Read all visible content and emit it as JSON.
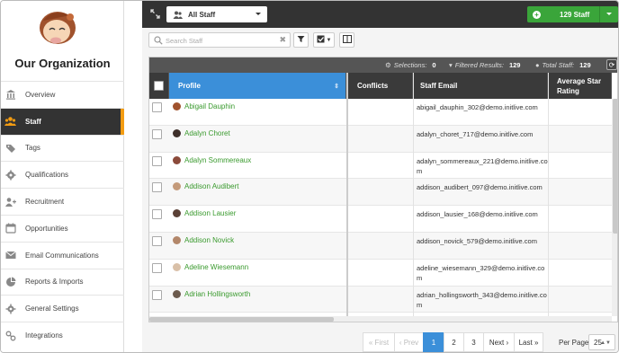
{
  "org": {
    "title": "Our Organization"
  },
  "sidebar": {
    "items": [
      {
        "label": "Overview",
        "icon": "bank-icon",
        "active": false
      },
      {
        "label": "Staff",
        "icon": "users-icon",
        "active": true
      },
      {
        "label": "Tags",
        "icon": "tags-icon",
        "active": false
      },
      {
        "label": "Qualifications",
        "icon": "gear-icon",
        "active": false
      },
      {
        "label": "Recruitment",
        "icon": "user-plus-icon",
        "active": false
      },
      {
        "label": "Opportunities",
        "icon": "calendar-icon",
        "active": false
      },
      {
        "label": "Email Communications",
        "icon": "envelope-icon",
        "active": false
      },
      {
        "label": "Reports & Imports",
        "icon": "pie-chart-icon",
        "active": false
      },
      {
        "label": "General Settings",
        "icon": "cog-icon",
        "active": false
      },
      {
        "label": "Integrations",
        "icon": "link-icon",
        "active": false
      }
    ]
  },
  "topbar": {
    "filter_select": "All Staff",
    "add_button": "129 Staff"
  },
  "search": {
    "placeholder": "Search Staff",
    "value": ""
  },
  "stats": {
    "selections_label": "Selections:",
    "selections": "0",
    "filtered_label": "Filtered Results:",
    "filtered": "129",
    "total_label": "Total Staff:",
    "total": "129"
  },
  "table": {
    "headers": {
      "profile": "Profile",
      "conflicts": "Conflicts",
      "email": "Staff Email",
      "rating": "Average Star Rating"
    },
    "rows": [
      {
        "name": "Abigail Dauphin",
        "email": "abigail_dauphin_302@demo.initlive.com",
        "avatar": "#a0522d"
      },
      {
        "name": "Adalyn Choret",
        "email": "adalyn_choret_717@demo.initlive.com",
        "avatar": "#3e2f2a"
      },
      {
        "name": "Adalyn Sommereaux",
        "email": "adalyn_sommereaux_221@demo.initlive.com",
        "avatar": "#8b4a3a"
      },
      {
        "name": "Addison Audibert",
        "email": "addison_audibert_097@demo.initlive.com",
        "avatar": "#c49a7a"
      },
      {
        "name": "Addison Lausier",
        "email": "addison_lausier_168@demo.initlive.com",
        "avatar": "#5a4036"
      },
      {
        "name": "Addison Novick",
        "email": "addison_novick_579@demo.initlive.com",
        "avatar": "#b3876a"
      },
      {
        "name": "Adeline Wiesemann",
        "email": "adeline_wiesemann_329@demo.initlive.com",
        "avatar": "#d9c0a8"
      },
      {
        "name": "Adrian Hollingsworth",
        "email": "adrian_hollingsworth_343@demo.initlive.com",
        "avatar": "#6b5a4d"
      }
    ]
  },
  "pagination": {
    "first": "« First",
    "prev": "‹ Prev",
    "pages": [
      "1",
      "2",
      "3"
    ],
    "current": "1",
    "next": "Next ›",
    "last": "Last »",
    "per_page_label": "Per Page",
    "per_page": "25"
  },
  "colors": {
    "accent": "#3b8fd9",
    "active_marker": "#f39c12",
    "success": "#3aa53a",
    "link": "#3a9a2e"
  }
}
